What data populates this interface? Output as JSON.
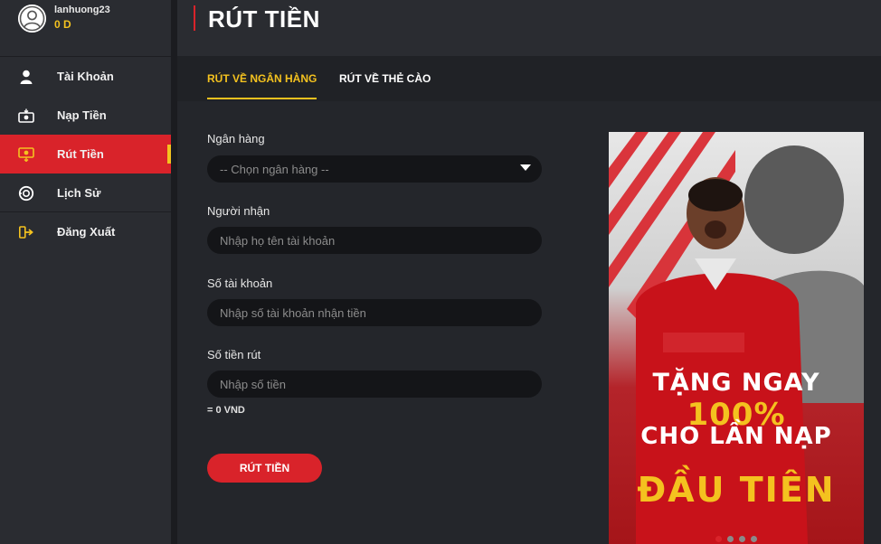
{
  "user": {
    "username": "lanhuong23",
    "balance": "0 D"
  },
  "sidebar": {
    "items": [
      {
        "label": "Tài Khoản",
        "icon": "user-icon"
      },
      {
        "label": "Nạp Tiền",
        "icon": "deposit-icon"
      },
      {
        "label": "Rút Tiền",
        "icon": "withdraw-icon",
        "active": true
      },
      {
        "label": "Lịch Sử",
        "icon": "history-icon"
      },
      {
        "label": "Đăng Xuất",
        "icon": "logout-icon"
      }
    ]
  },
  "header": {
    "title": "RÚT TIỀN"
  },
  "tabs": [
    {
      "label": "RÚT VỀ NGÂN HÀNG",
      "active": true
    },
    {
      "label": "RÚT VỀ THẺ CÀO",
      "active": false
    }
  ],
  "form": {
    "bank_label": "Ngân hàng",
    "bank_placeholder": "-- Chọn ngân hàng --",
    "recipient_label": "Người nhận",
    "recipient_placeholder": "Nhập họ tên tài khoản",
    "account_label": "Số tài khoản",
    "account_placeholder": "Nhập số tài khoản nhận tiền",
    "amount_label": "Số tiền rút",
    "amount_placeholder": "Nhập số tiền",
    "converted_value": "= 0 VND",
    "submit_label": "RÚT TIỀN"
  },
  "banner": {
    "line1_prefix": "TẶNG NGAY ",
    "line1_highlight": "100%",
    "line2": "CHO LẦN NẠP",
    "line3": "ĐẦU TIÊN",
    "slide_count": 4,
    "active_slide": 0
  },
  "colors": {
    "accent_red": "#d9232a",
    "accent_yellow": "#f4c21f",
    "sidebar_bg": "#2a2c31",
    "input_bg": "#141518"
  }
}
